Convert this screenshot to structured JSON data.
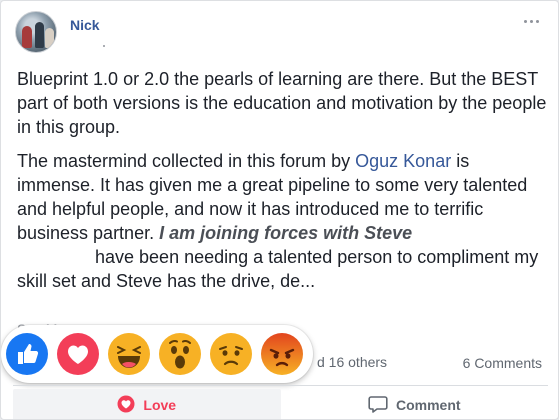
{
  "post": {
    "author": "Nick",
    "paragraph1": "Blueprint 1.0 or 2.0 the pearls of learning are there. But the BEST part of both versions is the education and motivation by the people in this group.",
    "paragraph2_a": "The mastermind collected in this forum by ",
    "paragraph2_link": "Oguz Konar",
    "paragraph2_b": " is immense. It has given me a great pipeline to some very talented and helpful people, and now it has introduced me to terrific business partner. ",
    "paragraph2_emph": "I am joining forces with Steve",
    "paragraph2_c": "have been needing a talented person to compliment my skill set and Steve has the drive, de...",
    "see_more": "See More"
  },
  "stats": {
    "others": "d 16 others",
    "comments": "6 Comments"
  },
  "reactions": [
    {
      "name": "like",
      "color": "#1877f2"
    },
    {
      "name": "love",
      "color": "#f33e58"
    },
    {
      "name": "haha",
      "color": "#f7b125"
    },
    {
      "name": "wow",
      "color": "#f7b125"
    },
    {
      "name": "sad",
      "color": "#f7b125"
    },
    {
      "name": "angry",
      "color": "#e9710f"
    }
  ],
  "actions": {
    "love_label": "Love",
    "comment_label": "Comment"
  }
}
